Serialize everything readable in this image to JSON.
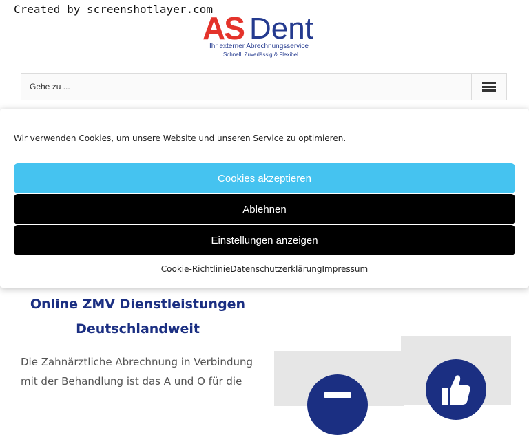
{
  "watermark": "Created by screenshotlayer.com",
  "logo": {
    "brand_as": "AS",
    "brand_dent": "Dent",
    "tagline": "Ihr externer Abrechnungsservice",
    "subtagline": "Schnell, Zuverlässig & Flexibel"
  },
  "nav": {
    "goto_label": "Gehe zu ...",
    "menu_icon": "hamburger-icon"
  },
  "cookie_banner": {
    "message": "Wir verwenden Cookies, um unsere Website und unseren Service zu optimieren.",
    "accept_label": "Cookies akzeptieren",
    "deny_label": "Ablehnen",
    "settings_label": "Einstellungen anzeigen",
    "links": [
      "Cookie-Richtlinie",
      "Datenschutzerklärung",
      "Impressum"
    ]
  },
  "content": {
    "title_line1": "Online ZMV Dienstleistungen",
    "title_line2": "Deutschlandweit",
    "text_line1": "Die Zahnärztliche Abrechnung in Verbindung",
    "text_line2": "mit der Behandlung ist das A und O für die"
  },
  "colors": {
    "brand_red": "#e4332b",
    "brand_blue": "#243a8f",
    "accept_button": "#45c3f0",
    "dark_button": "#000000"
  }
}
